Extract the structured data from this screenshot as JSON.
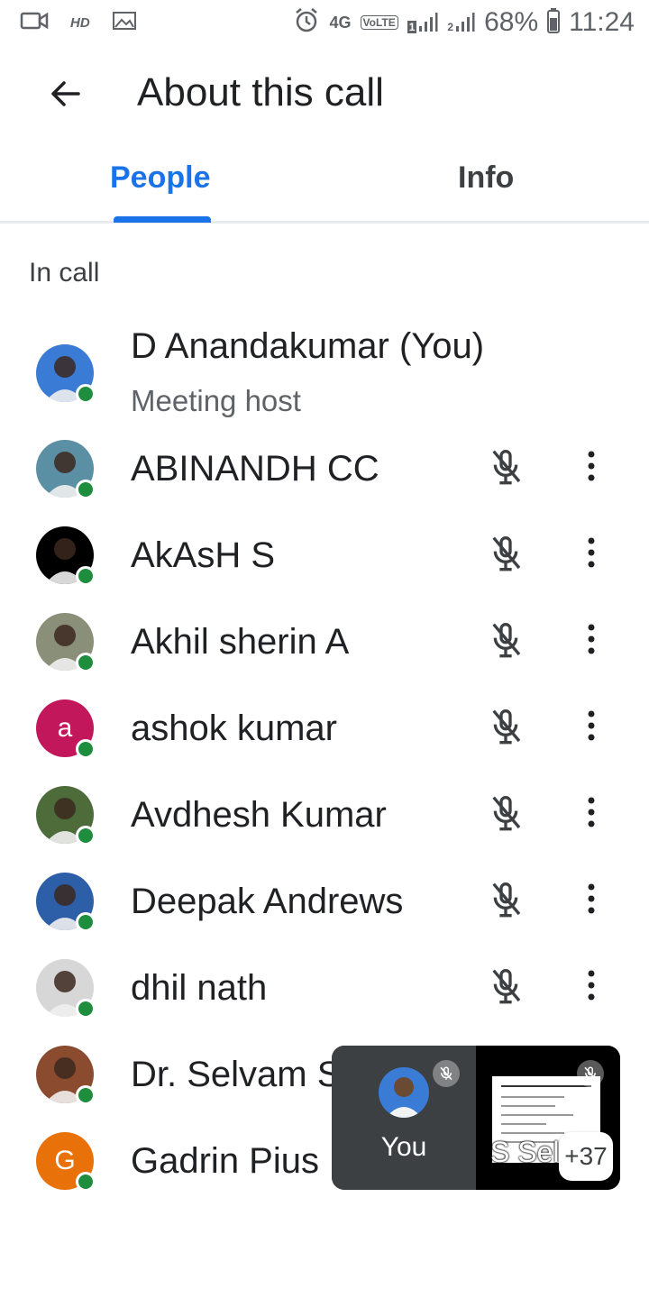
{
  "status_bar": {
    "hd": "HD",
    "network": "4G",
    "volte": "VoLTE",
    "sim1": "1",
    "sim2": "2",
    "battery": "68%",
    "time": "11:24"
  },
  "app_bar": {
    "title": "About this call"
  },
  "tabs": [
    {
      "label": "People",
      "active": true
    },
    {
      "label": "Info",
      "active": false
    }
  ],
  "section_header": "In call",
  "participants": [
    {
      "name": "D Anandakumar (You)",
      "subtitle": "Meeting host",
      "avatar_color": "#3a7bd5",
      "initial": ""
    },
    {
      "name": "ABINANDH CC",
      "avatar_color": "#5b8fa3",
      "initial": ""
    },
    {
      "name": "AkAsH S",
      "avatar_color": "#000000",
      "initial": ""
    },
    {
      "name": "Akhil sherin A",
      "avatar_color": "#8a8f7a",
      "initial": ""
    },
    {
      "name": "ashok kumar",
      "avatar_color": "#c2185b",
      "initial": "a"
    },
    {
      "name": "Avdhesh Kumar",
      "avatar_color": "#4e6b3a",
      "initial": ""
    },
    {
      "name": "Deepak Andrews",
      "avatar_color": "#2d5fa8",
      "initial": ""
    },
    {
      "name": "dhil nath",
      "avatar_color": "#d7d7d7",
      "initial": ""
    },
    {
      "name": "Dr. Selvam S",
      "avatar_color": "#8b4b2f",
      "initial": ""
    },
    {
      "name": "Gadrin Pius",
      "avatar_color": "#e8710a",
      "initial": "G"
    }
  ],
  "pip": {
    "self_label": "You",
    "other_name": "S Sel",
    "more_count": "+37"
  },
  "colors": {
    "accent": "#1a73e8",
    "online": "#1e8e3e"
  }
}
